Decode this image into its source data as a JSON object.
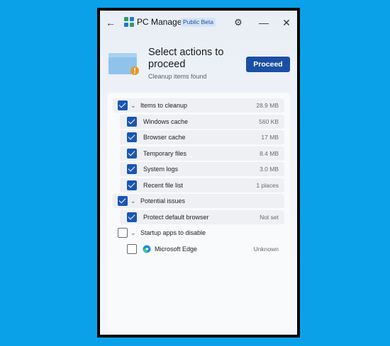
{
  "window": {
    "title": "PC Manager",
    "badge": "Public Beta",
    "icons": {
      "back": "back-arrow-icon",
      "settings": "gear-icon",
      "minimize": "minimize-icon",
      "close": "close-icon"
    }
  },
  "header": {
    "headline": "Select actions to proceed",
    "subtitle": "Cleanup items found",
    "proceed_label": "Proceed"
  },
  "groups": [
    {
      "label": "Items to cleanup",
      "value": "28.9 MB",
      "checked": true,
      "items": [
        {
          "label": "Windows cache",
          "value": "560 KB",
          "checked": true
        },
        {
          "label": "Browser cache",
          "value": "17 MB",
          "checked": true
        },
        {
          "label": "Temporary files",
          "value": "8.4 MB",
          "checked": true
        },
        {
          "label": "System logs",
          "value": "3.0 MB",
          "checked": true
        },
        {
          "label": "Recent file list",
          "value": "1 places",
          "checked": true
        }
      ]
    },
    {
      "label": "Potential issues",
      "value": "",
      "checked": true,
      "items": [
        {
          "label": "Protect default browser",
          "value": "Not set",
          "checked": true
        }
      ]
    },
    {
      "label": "Startup apps to disable",
      "value": "",
      "checked": false,
      "items": [
        {
          "label": "Microsoft Edge",
          "value": "Unknown",
          "checked": false,
          "icon": "edge-icon"
        }
      ]
    }
  ],
  "colors": {
    "accent": "#1a4fa3",
    "checkbox": "#1a56b3",
    "background": "#0aa1e8"
  }
}
